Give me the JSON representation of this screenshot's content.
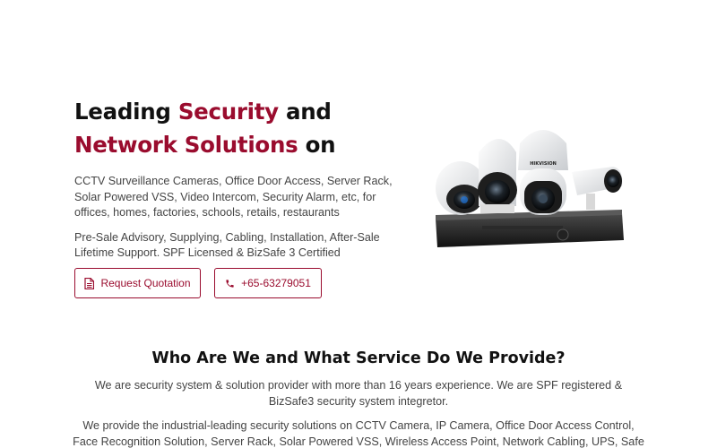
{
  "hero": {
    "title_part1": "Leading ",
    "title_accent1": "Security",
    "title_part2": " and ",
    "title_accent2": "Network Solutions",
    "title_part3": " on",
    "description": "CCTV Surveillance Cameras, Office Door Access, Server Rack, Solar Powered VSS, Video Intercom, Security Alarm, etc, for offices, homes, factories, schools, retails, restaurants",
    "services": "Pre-Sale Advisory, Supplying, Cabling, Installation, After-Sale Lifetime Support. SPF Licensed & BizSafe 3 Certified"
  },
  "buttons": {
    "quote_label": "Request Quotation",
    "quote_icon": "document-icon",
    "phone_label": "+65-63279051",
    "phone_icon": "phone-icon"
  },
  "image": {
    "brand_text": "HIKVISION"
  },
  "about": {
    "title": "Who Are We and What Service Do We Provide?",
    "paragraph1": "We are security system & solution provider with more than 16 years experience. We are SPF registered & BizSafe3 security system integretor.",
    "paragraph2": "We provide the industrial-leading security solutions on CCTV Camera, IP Camera, Office Door Access Control, Face Recognition Solution, Server Rack, Solar Powered VSS, Wireless Access Point, Network Cabling, UPS, Safe Box,"
  },
  "colors": {
    "accent": "#9a0c2e",
    "text": "#444444",
    "heading": "#111111"
  }
}
